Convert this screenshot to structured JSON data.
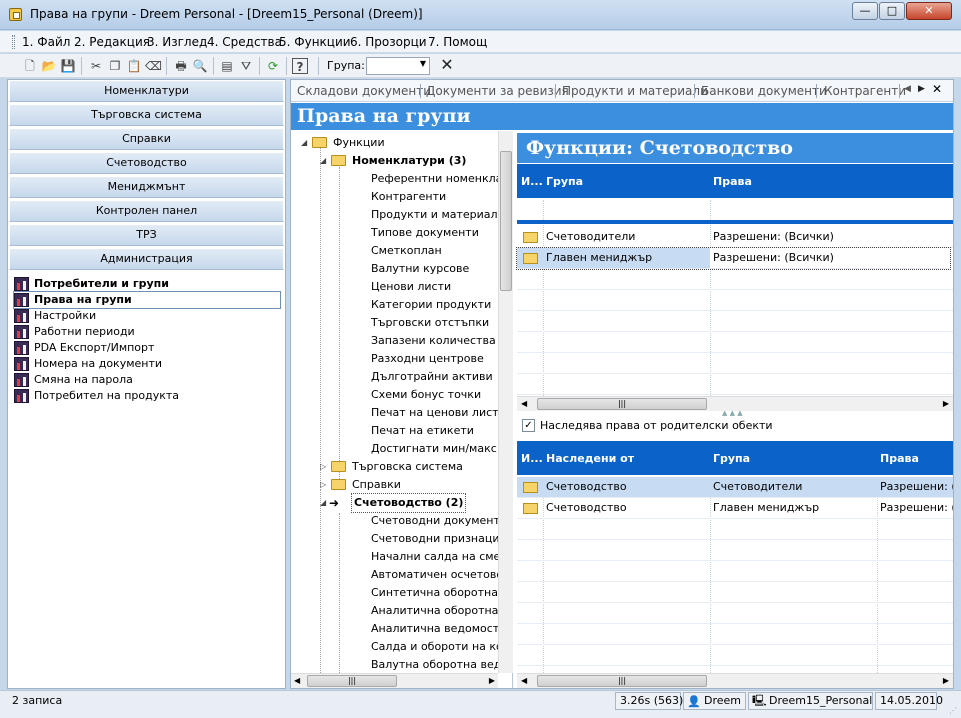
{
  "window": {
    "title": "Права на групи - Dreem Personal - [Dreem15_Personal (Dreem)]",
    "controls": {
      "minimize": "—",
      "maximize": "□",
      "close": "✕"
    }
  },
  "menu": [
    "1. Файл",
    "2. Редакция",
    "3. Изглед",
    "4. Средства",
    "5. Функции",
    "6. Прозорци",
    "7. Помощ"
  ],
  "toolbar": {
    "group_label": "Група:",
    "group_value": "",
    "clear_icon": "✕"
  },
  "left_nav": {
    "sections": [
      "Номенклатури",
      "Търговска система",
      "Справки",
      "Счетоводство",
      "Мениджмънт",
      "Контролен панел",
      "ТРЗ",
      "Администрация"
    ],
    "items": [
      {
        "label": "Потребители и групи",
        "bold": true
      },
      {
        "label": "Права на групи",
        "bold": true,
        "selected": true
      },
      {
        "label": "Настройки"
      },
      {
        "label": "Работни периоди"
      },
      {
        "label": "PDA Експорт/Импорт"
      },
      {
        "label": "Номера на документи"
      },
      {
        "label": "Смяна на парола"
      },
      {
        "label": "Потребител на продукта"
      }
    ]
  },
  "tabs": [
    "Складови документи",
    "Документи за ревизия",
    "Продукти и материали",
    "Банкови документи",
    "Контрагенти"
  ],
  "page_title": "Права на групи",
  "tree": {
    "root": "Функции",
    "nomenclatures": "Номенклатури (3)",
    "nom_children": [
      "Референтни номенкла",
      "Контрагенти",
      "Продукти и материали",
      "Типове документи",
      "Сметкоплан",
      "Валутни курсове",
      "Ценови листи",
      "Категории продукти",
      "Търговски отстъпки",
      "Запазени количества",
      "Разходни центрове",
      "Дълготрайни активи",
      "Схеми бонус точки",
      "Печат на ценови листи",
      "Печат на етикети",
      "Достигнати мин/макс"
    ],
    "trade": "Търговска система",
    "reports": "Справки",
    "accounting": "Счетоводство (2)",
    "acc_children": [
      "Счетоводни документи",
      "Счетоводни признаци",
      "Начални салда на смет",
      "Автоматичен осчетово",
      "Синтетична оборотна",
      "Аналитична оборотна",
      "Аналитична ведомост",
      "Салда и обороти на ко",
      "Валутна оборотна ведо"
    ]
  },
  "functions_title": "Функции: Счетоводство",
  "grid1": {
    "headers": [
      "И...",
      "Група",
      "Права"
    ],
    "rows": [
      {
        "group": "Счетоводители",
        "rights": "Разрешени: (Всички)"
      },
      {
        "group": "Главен мениджър",
        "rights": "Разрешени: (Всички)"
      }
    ]
  },
  "inherit_checkbox": {
    "label": "Наследява права от родителски обекти",
    "checked": true,
    "mark": "✓"
  },
  "grid2": {
    "headers": [
      "И...",
      "Наследени от",
      "Група",
      "Права"
    ],
    "rows": [
      {
        "from": "Счетоводство",
        "group": "Счетоводители",
        "rights": "Разрешени: (Всички)"
      },
      {
        "from": "Счетоводство",
        "group": "Главен мениджър",
        "rights": "Разрешени: (Всички)"
      }
    ]
  },
  "status": {
    "records": "2 записа",
    "timing": "3.26s (563)",
    "user": "Dreem",
    "database": "Dreem15_Personal",
    "date": "14.05.2010"
  },
  "colors": {
    "accent": "#3b8fde",
    "grid_header": "#0b63c9",
    "selection": "#c7dcf3"
  }
}
